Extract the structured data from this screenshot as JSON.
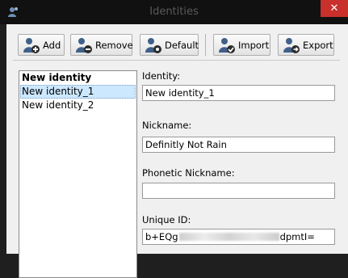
{
  "window": {
    "title": "Identities",
    "close_glyph": "✕"
  },
  "toolbar": {
    "buttons": [
      {
        "label": "Add",
        "icon": "user-add-icon"
      },
      {
        "label": "Remove",
        "icon": "user-remove-icon"
      },
      {
        "label": "Default",
        "icon": "user-default-icon"
      },
      {
        "label": "Import",
        "icon": "user-import-icon"
      },
      {
        "label": "Export",
        "icon": "user-export-icon"
      }
    ]
  },
  "identity_list": {
    "items": [
      {
        "label": "New identity",
        "bold": true,
        "selected": false
      },
      {
        "label": "New identity_1",
        "bold": false,
        "selected": true
      },
      {
        "label": "New identity_2",
        "bold": false,
        "selected": false
      }
    ]
  },
  "form": {
    "identity_label": "Identity:",
    "identity_value": "New identity_1",
    "nickname_label": "Nickname:",
    "nickname_value": "Definitly Not Rain",
    "phonetic_label": "Phonetic Nickname:",
    "phonetic_value": "",
    "uid_label": "Unique ID:",
    "uid_prefix": "b+EQg",
    "uid_suffix": "dpmtI="
  },
  "colors": {
    "accent": "#cce8ff",
    "icon_blue": "#40608a",
    "close_red": "#c9302c"
  }
}
